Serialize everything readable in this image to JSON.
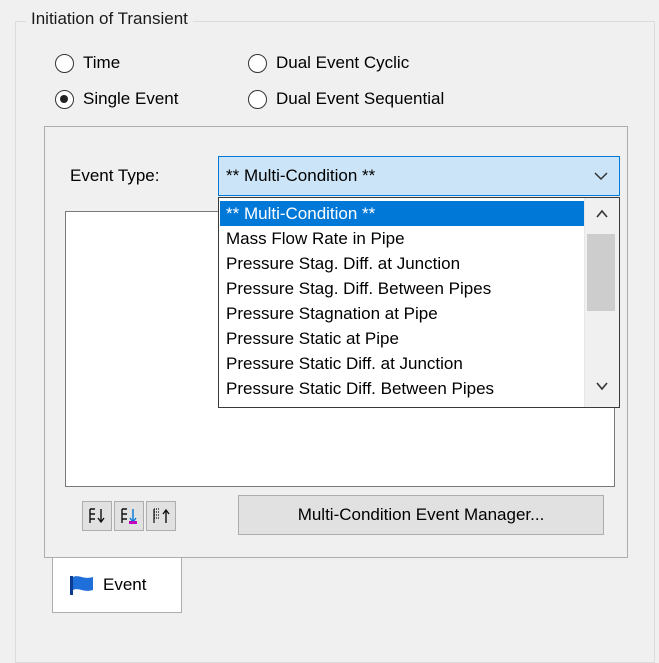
{
  "group": {
    "title": "Initiation of Transient"
  },
  "radios": [
    {
      "label": "Time",
      "checked": false
    },
    {
      "label": "Dual Event Cyclic",
      "checked": false
    },
    {
      "label": "Single Event",
      "checked": true
    },
    {
      "label": "Dual Event Sequential",
      "checked": false
    }
  ],
  "event_type": {
    "label": "Event Type:",
    "selected": "** Multi-Condition **",
    "options": [
      "** Multi-Condition **",
      "Mass Flow Rate in Pipe",
      "Pressure Stag. Diff. at Junction",
      "Pressure Stag. Diff. Between Pipes",
      "Pressure Stagnation at Pipe",
      "Pressure Static at Pipe",
      "Pressure Static Diff. at Junction",
      "Pressure Static Diff. Between Pipes"
    ]
  },
  "buttons": {
    "manager": "Multi-Condition Event Manager..."
  },
  "tools": [
    "sort-down-icon",
    "sort-color-icon",
    "sort-up-icon"
  ],
  "tab": {
    "label": "Event",
    "icon": "flag-icon"
  },
  "colors": {
    "selection": "#0078d7",
    "combo_bg": "#cce4f7"
  }
}
